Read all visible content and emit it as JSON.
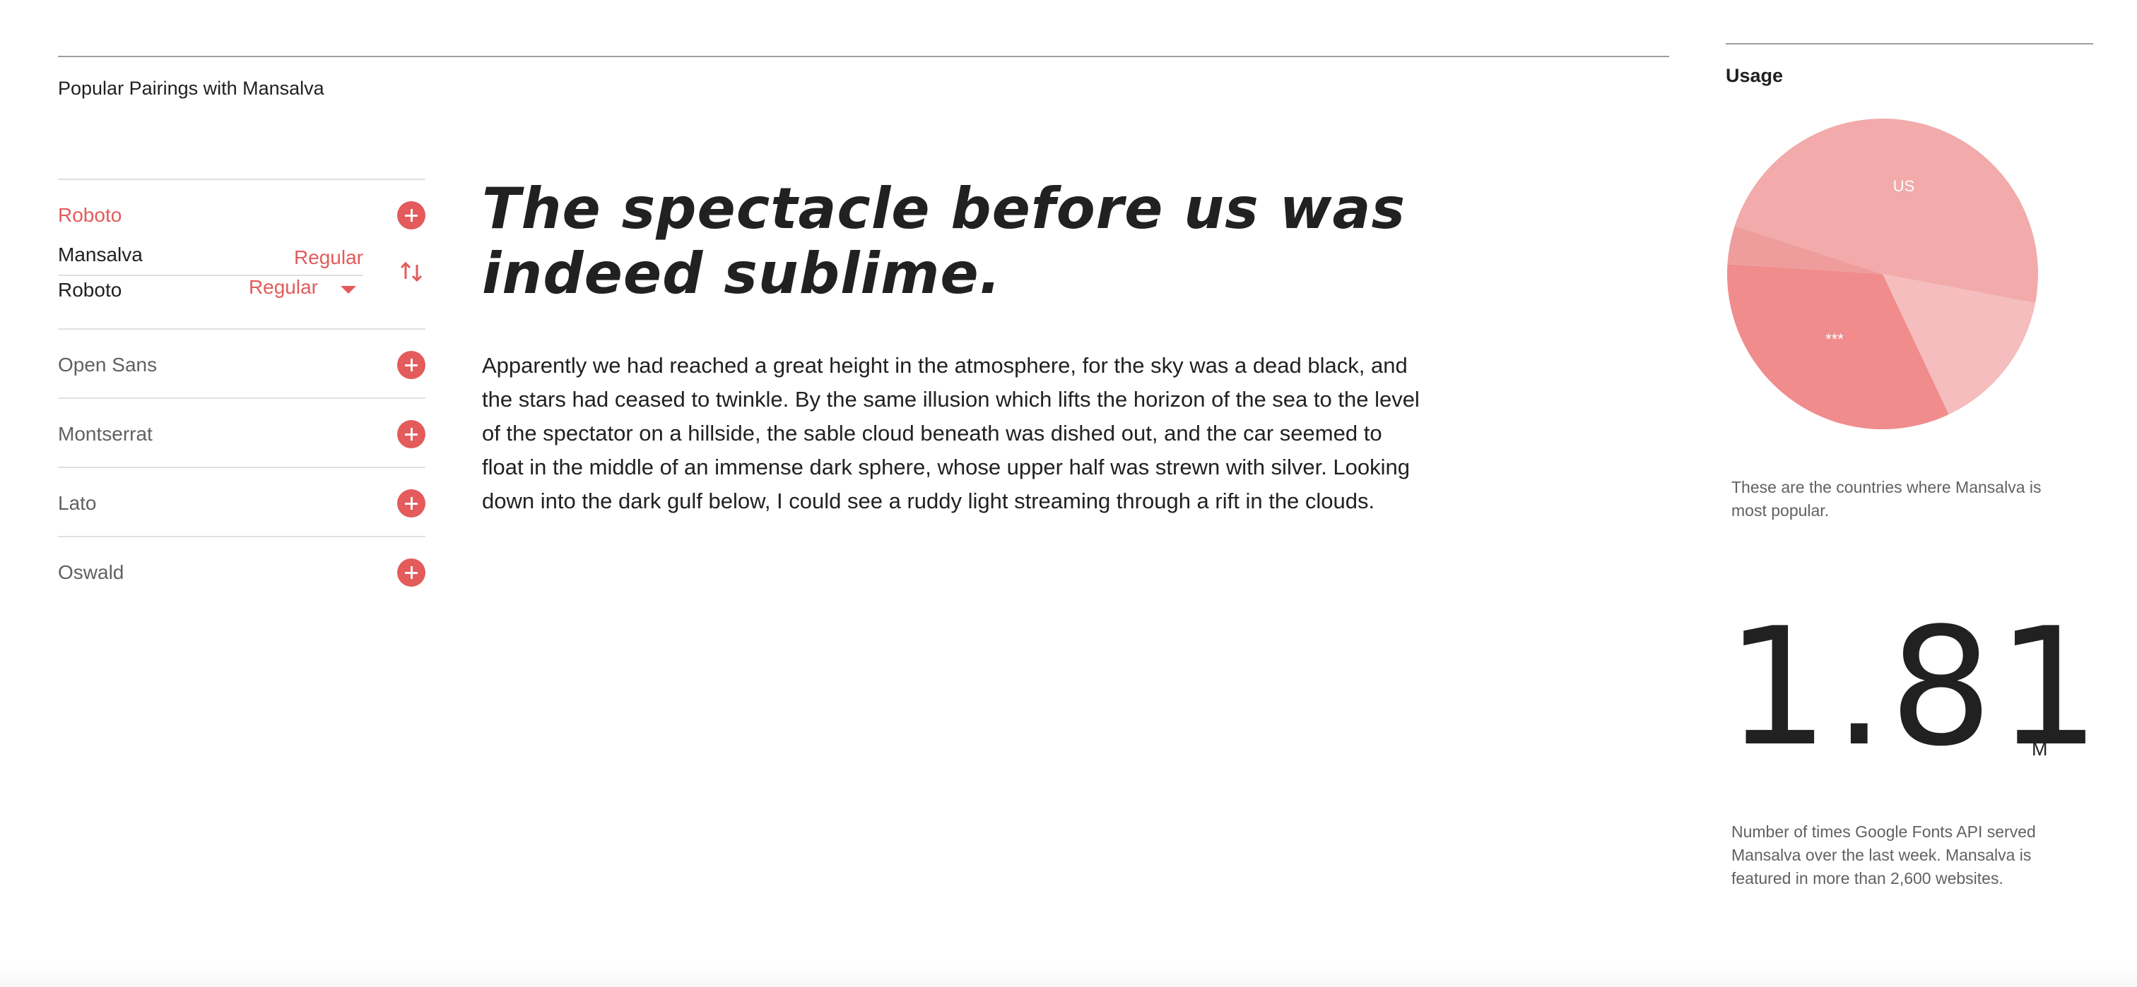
{
  "header": {
    "title": "Popular Pairings with Mansalva"
  },
  "pairings": {
    "active": {
      "label": "Roboto",
      "primary_font": "Mansalva",
      "primary_weight": "Regular",
      "secondary_font": "Roboto",
      "secondary_weight": "Regular"
    },
    "items": [
      {
        "label": "Open Sans"
      },
      {
        "label": "Montserrat"
      },
      {
        "label": "Lato"
      },
      {
        "label": "Oswald"
      }
    ]
  },
  "preview": {
    "heading": "The spectacle before us was indeed sublime.",
    "body": "Apparently we had reached a great height in the atmosphere, for the sky was a dead black, and the stars had ceased to twinkle. By the same illusion which lifts the horizon of the sea to the level of the spectator on a hillside, the sable cloud beneath was dished out, and the car seemed to float in the middle of an immense dark sphere, whose upper half was strewn with silver. Looking down into the dark gulf below, I could see a ruddy light streaming through a rift in the clouds."
  },
  "usage": {
    "title": "Usage",
    "caption": "These are the countries where Mansalva is most popular.",
    "big_number": "1.81",
    "big_unit": "M",
    "count_caption": "Number of times Google Fonts API served Mansalva over the last week. Mansalva is featured in more than 2,600 websites."
  },
  "chart_data": {
    "type": "pie",
    "slices": [
      {
        "label": "US",
        "value": 48,
        "color": "#f2aaaa"
      },
      {
        "label": "",
        "value": 15,
        "color": "#f5bdbd"
      },
      {
        "label": "***",
        "value": 33,
        "color": "#f08c8c"
      },
      {
        "label": "",
        "value": 4,
        "color": "#ef9c9c"
      }
    ]
  },
  "colors": {
    "accent": "#e35b5b",
    "text": "#212121",
    "muted": "#616161"
  }
}
